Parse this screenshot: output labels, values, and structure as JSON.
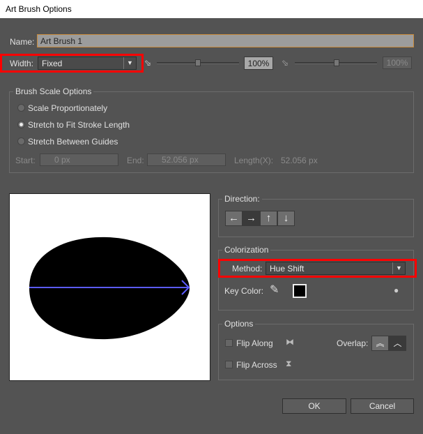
{
  "window": {
    "title": "Art Brush Options"
  },
  "name": {
    "label": "Name:",
    "value": "Art Brush 1"
  },
  "width": {
    "label": "Width:",
    "value": "Fixed",
    "percent1": "100%",
    "percent2": "100%"
  },
  "brush_scale": {
    "title": "Brush Scale Options",
    "options": [
      "Scale Proportionately",
      "Stretch to Fit Stroke Length",
      "Stretch Between Guides"
    ],
    "selected": 1,
    "start_label": "Start:",
    "start_value": "0 px",
    "end_label": "End:",
    "end_value": "52.056 px",
    "length_label": "Length(X):",
    "length_value": "52.056 px"
  },
  "direction": {
    "title": "Direction:",
    "buttons": [
      "←",
      "→",
      "↑",
      "↓"
    ],
    "selected": 1
  },
  "colorization": {
    "title": "Colorization",
    "method_label": "Method:",
    "method_value": "Hue Shift",
    "key_color_label": "Key Color:",
    "key_color": "#000000"
  },
  "options": {
    "title": "Options",
    "flip_along": "Flip Along",
    "flip_across": "Flip Across",
    "overlap_label": "Overlap:"
  },
  "preview": {
    "shape_color": "#000000",
    "arrow_color": "#5b5bff"
  },
  "buttons": {
    "ok": "OK",
    "cancel": "Cancel"
  }
}
